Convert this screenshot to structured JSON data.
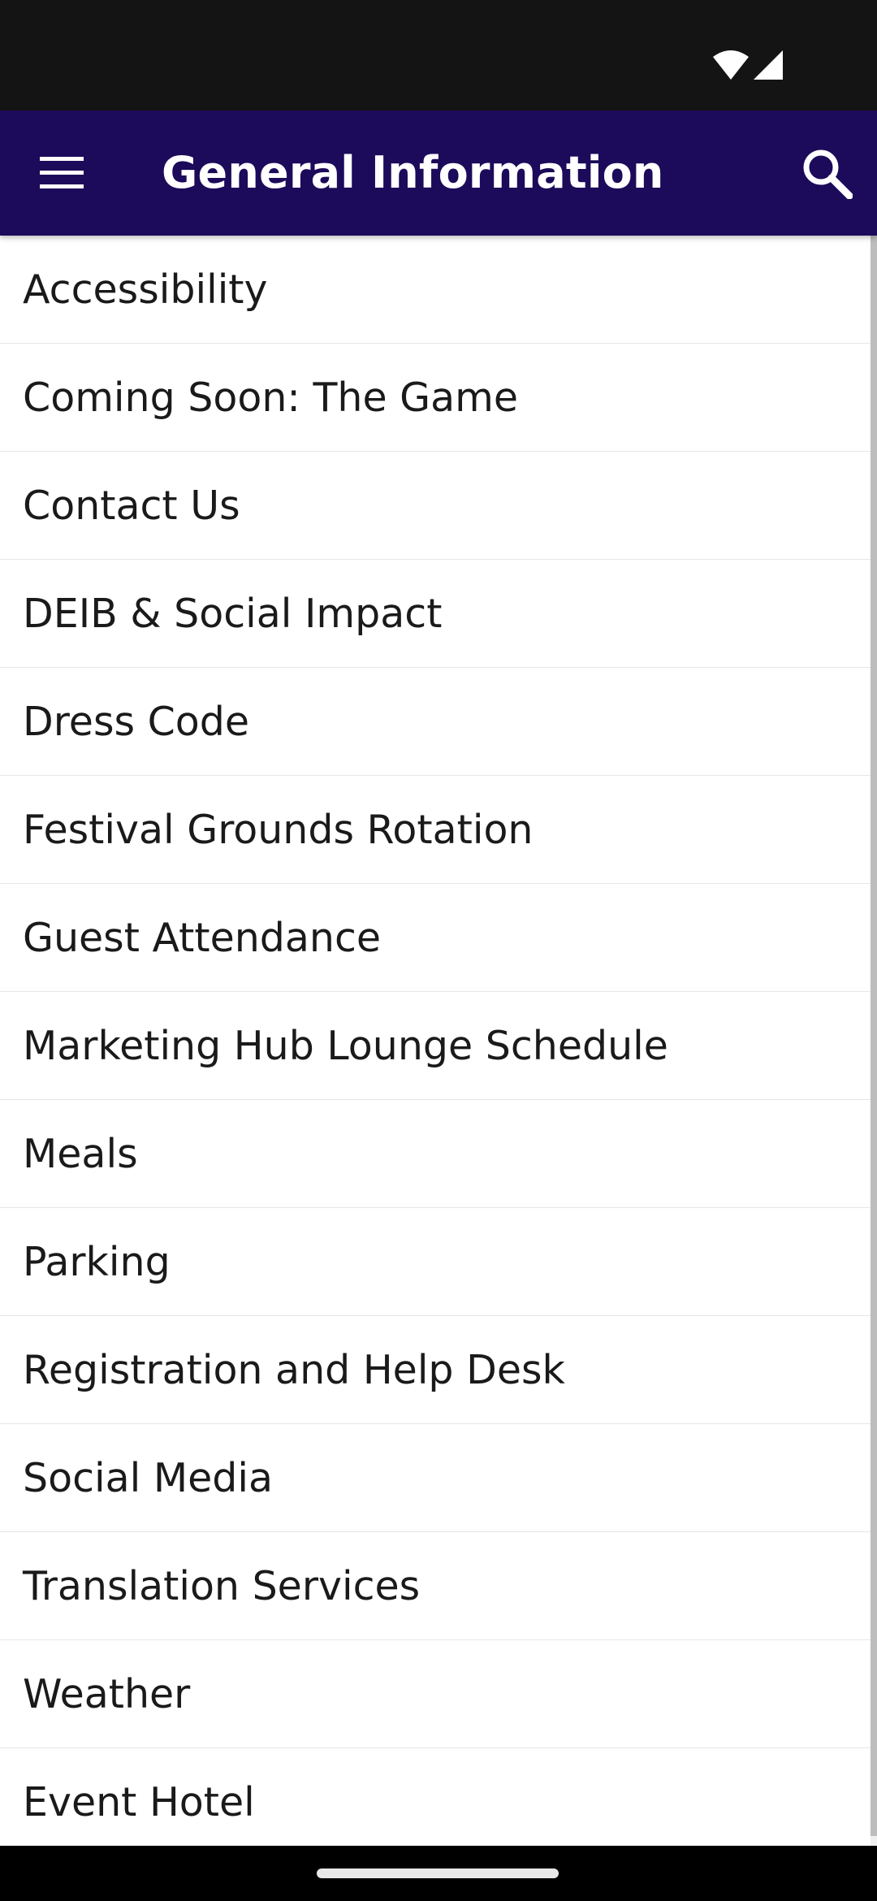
{
  "status_bar": {
    "icons": [
      "wifi-icon",
      "cellular-signal-icon"
    ]
  },
  "app_bar": {
    "title": "General Information",
    "menu_icon": "hamburger-menu-icon",
    "search_icon": "search-icon",
    "background_color": "#1c0a5a"
  },
  "list": {
    "items": [
      {
        "label": "Accessibility"
      },
      {
        "label": "Coming Soon: The Game"
      },
      {
        "label": "Contact Us"
      },
      {
        "label": "DEIB & Social Impact"
      },
      {
        "label": "Dress Code"
      },
      {
        "label": "Festival Grounds Rotation"
      },
      {
        "label": "Guest Attendance"
      },
      {
        "label": "Marketing Hub Lounge Schedule"
      },
      {
        "label": "Meals"
      },
      {
        "label": "Parking"
      },
      {
        "label": "Registration and Help Desk"
      },
      {
        "label": "Social Media"
      },
      {
        "label": "Translation Services"
      },
      {
        "label": "Weather"
      },
      {
        "label": "Event Hotel"
      }
    ]
  }
}
